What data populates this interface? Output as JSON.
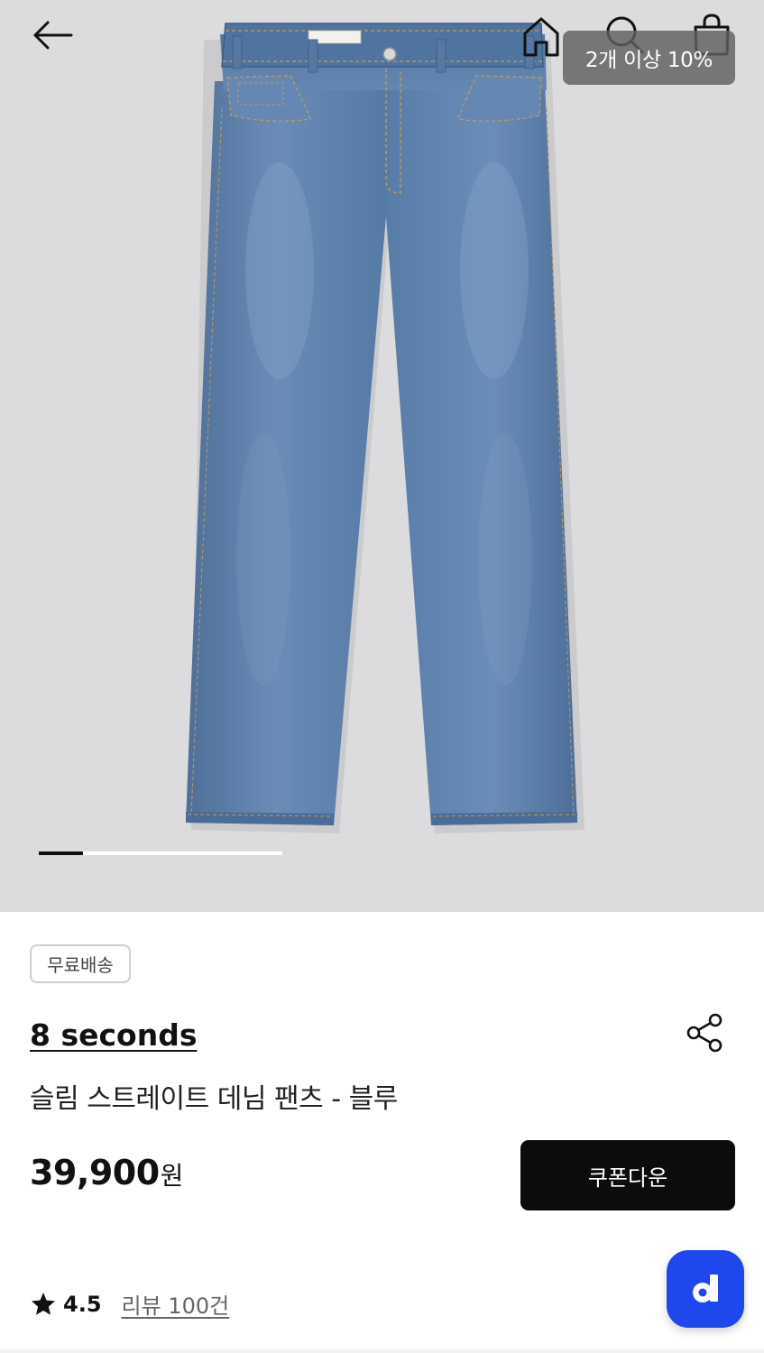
{
  "header": {
    "back_icon": "arrow-left-icon",
    "home_icon": "home-icon",
    "search_icon": "search-icon",
    "cart_icon": "shopping-bag-icon",
    "promo_tooltip": "2개 이상 10%"
  },
  "gallery": {
    "image": "blue-denim-jeans-product-photo",
    "background_color": "#dcdbde",
    "pager_progress": 0.18
  },
  "product": {
    "badge": "무료배송",
    "brand": "8 seconds",
    "name": "슬림 스트레이트 데님 팬츠 - 블루",
    "price": "39,900",
    "price_unit": "원",
    "coupon_button": "쿠폰다운",
    "share_icon": "share-icon",
    "rating_icon": "star-icon",
    "rating": "4.5",
    "review_link": "리뷰 100건"
  },
  "floating": {
    "icon": "d-logo-icon",
    "label": "d",
    "color": "#1f47ee"
  },
  "colors": {
    "accent": "#0c0c0c",
    "floating": "#1f47ee"
  }
}
